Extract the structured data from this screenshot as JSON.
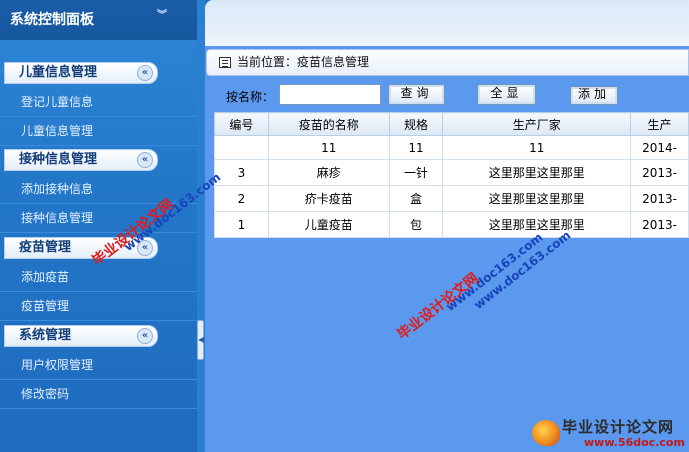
{
  "sidebar": {
    "title": "系统控制面板",
    "sections": [
      {
        "title": "儿童信息管理",
        "items": [
          "登记儿童信息",
          "儿童信息管理"
        ]
      },
      {
        "title": "接种信息管理",
        "items": [
          "添加接种信息",
          "接种信息管理"
        ]
      },
      {
        "title": "疫苗管理",
        "items": [
          "添加疫苗",
          "疫苗管理"
        ]
      },
      {
        "title": "系统管理",
        "items": [
          "用户权限管理",
          "修改密码"
        ]
      }
    ],
    "collapse_glyph": "«",
    "header_glyph": "︾"
  },
  "main": {
    "breadcrumb": "当前位置：疫苗信息管理",
    "search": {
      "label": "按名称：",
      "value": "",
      "query_label": "查询",
      "show_all_label": "全显",
      "add_label": "添加"
    },
    "table": {
      "columns": [
        "编号",
        "疫苗的名称",
        "规格",
        "生产厂家",
        "生产"
      ],
      "rows": [
        [
          "",
          "11",
          "11",
          "11",
          "2014-"
        ],
        [
          "3",
          "麻疹",
          "一针",
          "这里那里这里那里",
          "2013-"
        ],
        [
          "2",
          "疥卡疫苗",
          "盒",
          "这里那里这里那里",
          "2013-"
        ],
        [
          "1",
          "儿童疫苗",
          "包",
          "这里那里这里那里",
          "2013-"
        ]
      ]
    }
  },
  "watermarks": {
    "text_cn": "毕业设计论文网",
    "text_url": "www.doc163.com"
  },
  "brand": {
    "name": "毕业设计论文网",
    "url": "www.56doc.com"
  },
  "colors": {
    "sidebar_bg": "#2377c9",
    "main_bg": "#5a99ee",
    "section_text": "#123d7a",
    "watermark_red": "#e01b1b",
    "watermark_blue": "#1744b8"
  }
}
